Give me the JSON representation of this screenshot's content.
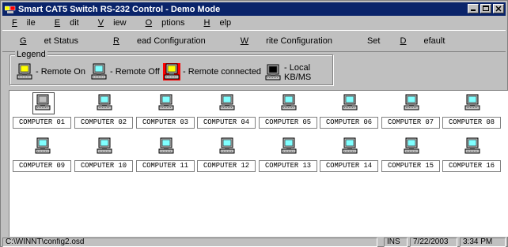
{
  "window": {
    "title": "Smart CAT5 Switch RS-232 Control - Demo Mode"
  },
  "menu": [
    {
      "label": "File",
      "accel": "F",
      "rest": "ile"
    },
    {
      "label": "Edit",
      "accel": "E",
      "rest": "dit"
    },
    {
      "label": "View",
      "accel": "V",
      "rest": "iew"
    },
    {
      "label": "Options",
      "accel": "O",
      "rest": "ptions"
    },
    {
      "label": "Help",
      "accel": "H",
      "rest": "elp"
    }
  ],
  "toolbar": {
    "get_status": {
      "accel": "G",
      "rest": "et Status"
    },
    "read_config": {
      "accel": "R",
      "rest": "ead Configuration"
    },
    "write_config": {
      "accel": "W",
      "rest": "rite Configuration"
    },
    "set_default": {
      "pre": "Set ",
      "accel": "D",
      "rest": "efault"
    }
  },
  "legend": {
    "title": "Legend",
    "items": [
      {
        "label": "- Remote On",
        "icon": "computer-on-icon",
        "screen": "#ffff00"
      },
      {
        "label": "- Remote Off",
        "icon": "computer-off-icon",
        "screen": "#80ffff"
      },
      {
        "label": "- Remote connected",
        "icon": "computer-connected-icon",
        "screen": "#ffff00",
        "frame": "#ff0000"
      },
      {
        "label": "- Local KB/MS",
        "icon": "computer-local-icon",
        "screen": "#000000"
      }
    ]
  },
  "computers": [
    {
      "label": "COMPUTER 01",
      "state": "selected"
    },
    {
      "label": "COMPUTER 02",
      "state": "off"
    },
    {
      "label": "COMPUTER 03",
      "state": "off"
    },
    {
      "label": "COMPUTER 04",
      "state": "off"
    },
    {
      "label": "COMPUTER 05",
      "state": "off"
    },
    {
      "label": "COMPUTER 06",
      "state": "off"
    },
    {
      "label": "COMPUTER 07",
      "state": "off"
    },
    {
      "label": "COMPUTER 08",
      "state": "off"
    },
    {
      "label": "COMPUTER 09",
      "state": "off"
    },
    {
      "label": "COMPUTER 10",
      "state": "off"
    },
    {
      "label": "COMPUTER 11",
      "state": "off"
    },
    {
      "label": "COMPUTER 12",
      "state": "off"
    },
    {
      "label": "COMPUTER 13",
      "state": "off"
    },
    {
      "label": "COMPUTER 14",
      "state": "off"
    },
    {
      "label": "COMPUTER 15",
      "state": "off"
    },
    {
      "label": "COMPUTER 16",
      "state": "off"
    }
  ],
  "status": {
    "file": "C:\\WINNT\\config2.osd",
    "mode": "INS",
    "date": "7/22/2003",
    "time": "3:34 PM"
  },
  "colors": {
    "titlebar": "#0a246a",
    "off_screen": "#80ffff",
    "on_screen": "#ffff00",
    "monitor": "#c0c0c0"
  }
}
